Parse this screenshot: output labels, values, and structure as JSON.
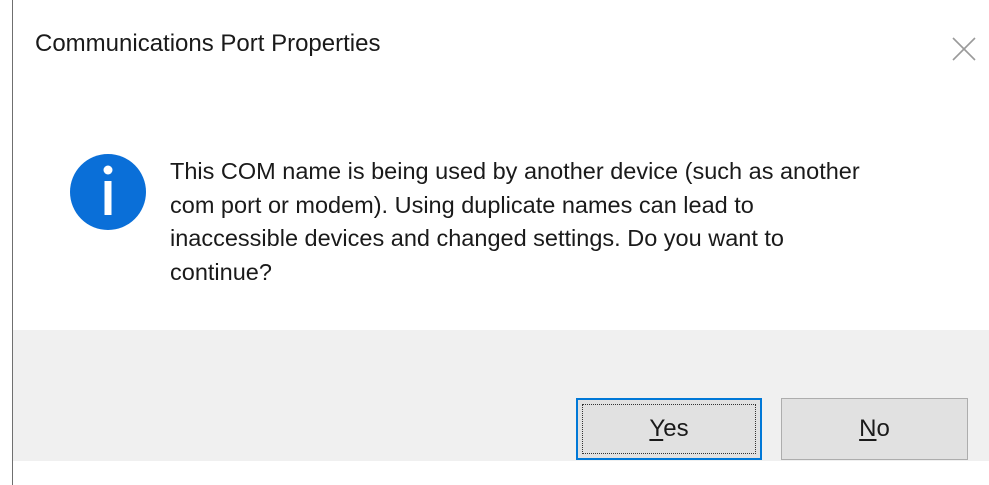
{
  "window": {
    "title": "Communications Port Properties"
  },
  "icons": {
    "close": "close-icon",
    "info": "info-icon"
  },
  "colors": {
    "info_icon_fill": "#0a6fd8",
    "default_button_border": "#0078d7",
    "footer_background": "#f0f0f0",
    "button_background": "#e1e1e1"
  },
  "dialog": {
    "message": "This COM name is being used by another device (such as another\ncom port or modem).  Using duplicate names can lead to\ninaccessible devices and changed settings.  Do you want to\ncontinue?"
  },
  "buttons": {
    "yes": {
      "accel": "Y",
      "rest": "es"
    },
    "no": {
      "accel": "N",
      "rest": "o"
    }
  }
}
